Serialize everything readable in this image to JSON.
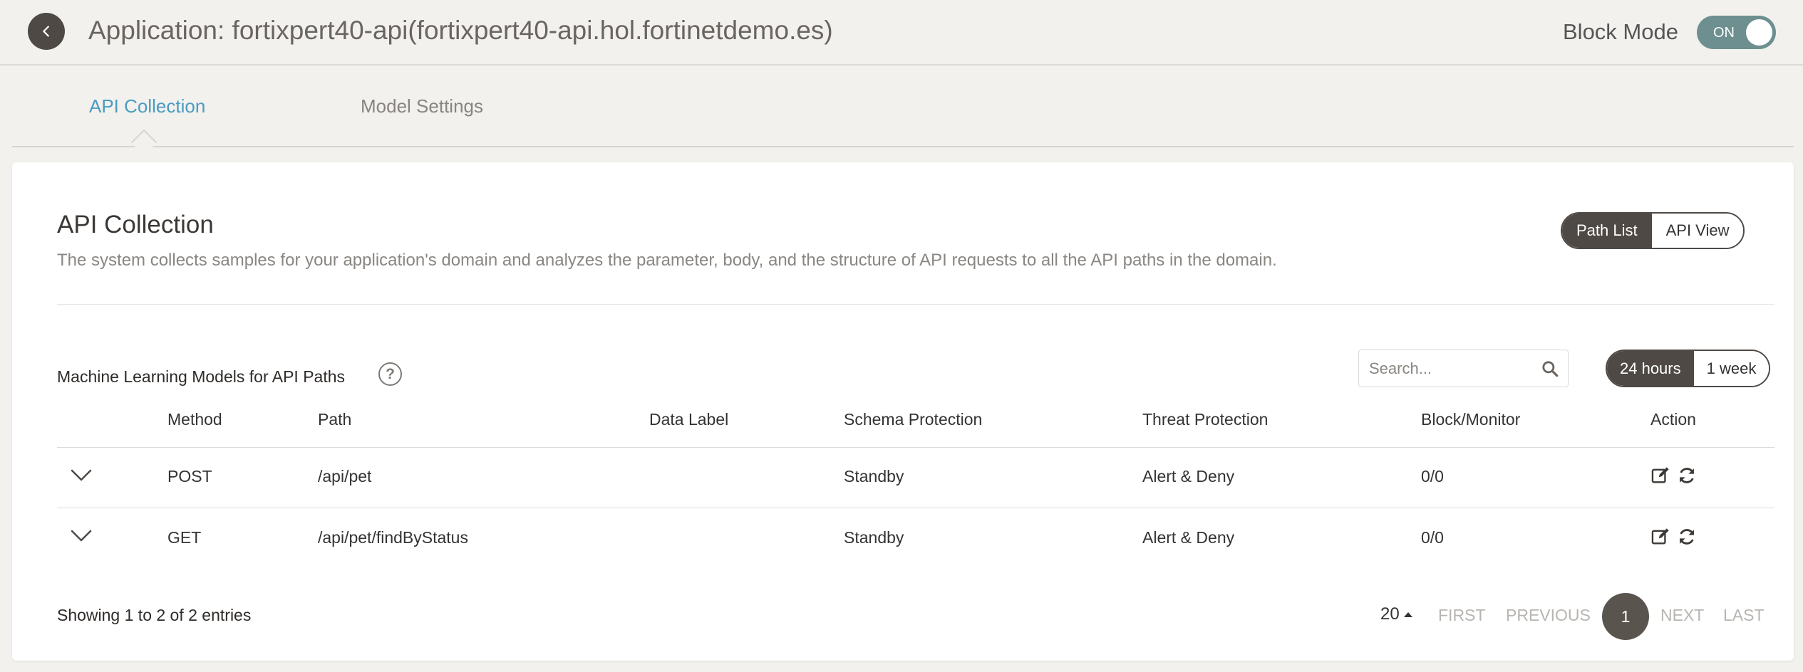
{
  "header": {
    "title": "Application: fortixpert40-api(fortixpert40-api.hol.fortinetdemo.es)",
    "block_mode_label": "Block Mode",
    "block_mode_toggle": "ON"
  },
  "tabs": [
    {
      "label": "API Collection",
      "active": true
    },
    {
      "label": "Model Settings",
      "active": false
    }
  ],
  "card": {
    "title": "API Collection",
    "description": "The system collects samples for your application's domain and analyzes the parameter, body, and the structure of API requests to all the API paths in the domain.",
    "view_switch": [
      "Path List",
      "API View"
    ],
    "section_title": "Machine Learning Models for API Paths",
    "search_placeholder": "Search...",
    "time_range": [
      "24 hours",
      "1 week"
    ]
  },
  "table": {
    "columns": [
      "Method",
      "Path",
      "Data Label",
      "Schema Protection",
      "Threat Protection",
      "Block/Monitor",
      "Action"
    ],
    "rows": [
      {
        "method": "POST",
        "path": "/api/pet",
        "data_label": "",
        "schema": "Standby",
        "threat": "Alert & Deny",
        "block_monitor": "0/0"
      },
      {
        "method": "GET",
        "path": "/api/pet/findByStatus",
        "data_label": "",
        "schema": "Standby",
        "threat": "Alert & Deny",
        "block_monitor": "0/0"
      }
    ]
  },
  "footer": {
    "entries_info": "Showing 1 to 2 of 2 entries",
    "page_size": "20",
    "first": "FIRST",
    "previous": "PREVIOUS",
    "current_page": "1",
    "next": "NEXT",
    "last": "LAST"
  },
  "colors": {
    "accent": "#4a9cc0",
    "dark": "#4e4945",
    "toggle_on": "#6d8f8f"
  },
  "icons": {
    "back": "chevron-left-icon",
    "help": "question-circle-icon",
    "search": "search-icon",
    "expand": "chevron-down-icon",
    "edit": "edit-icon",
    "refresh": "refresh-icon"
  }
}
